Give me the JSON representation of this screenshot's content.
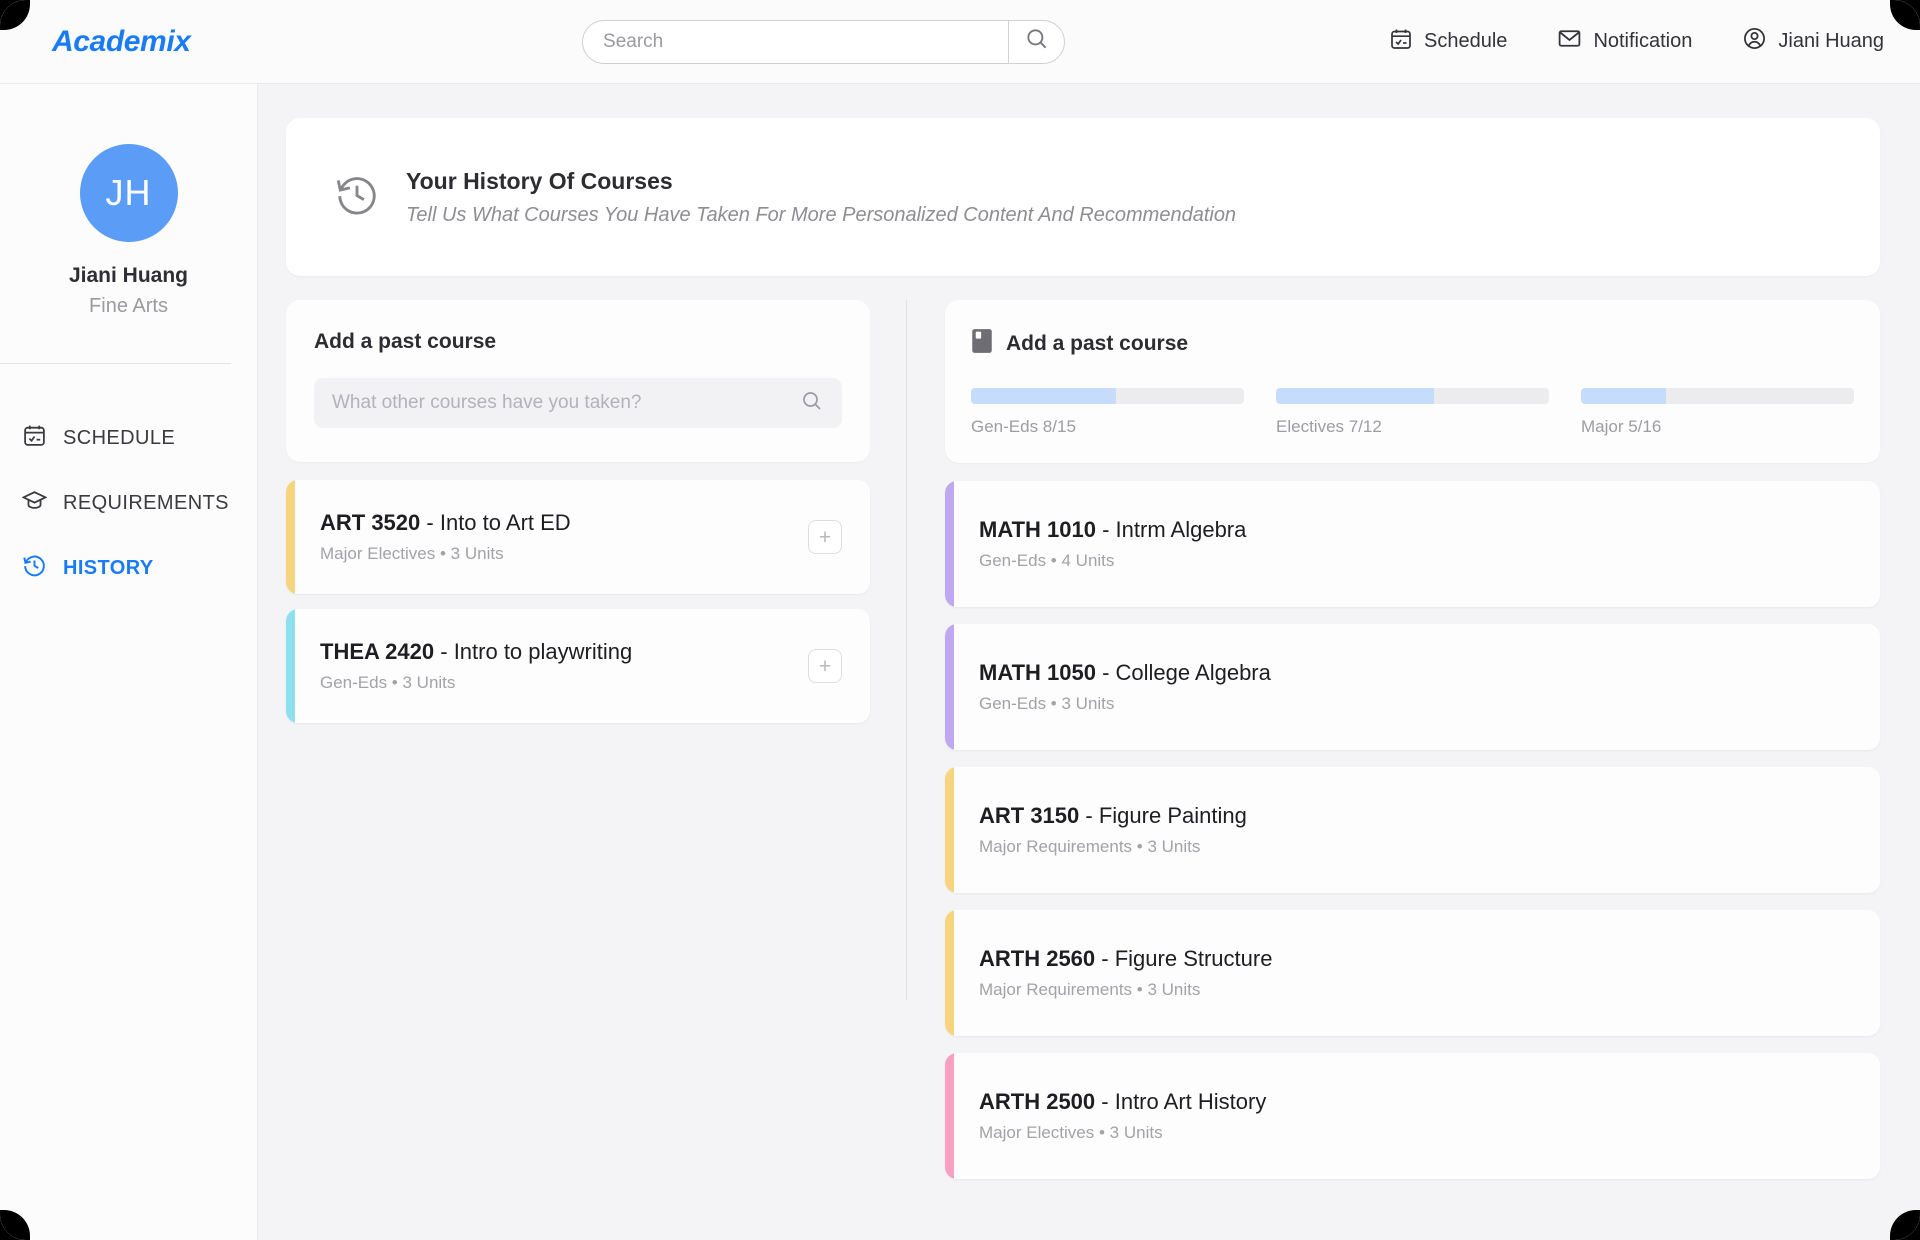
{
  "app": {
    "brand": "Academix"
  },
  "search": {
    "placeholder": "Search",
    "value": "",
    "icon": "search-icon"
  },
  "topnav": [
    {
      "label": "Schedule",
      "icon": "calendar-check-icon"
    },
    {
      "label": "Notification",
      "icon": "envelope-icon"
    },
    {
      "label": "Jiani Huang",
      "icon": "user-circle-icon"
    }
  ],
  "sidebar": {
    "profile": {
      "initials": "JH",
      "name": "Jiani Huang",
      "major": "Fine Arts",
      "avatar_color": "#5b9cf6"
    },
    "items": [
      {
        "label": "SCHEDULE",
        "icon": "calendar-icon",
        "active": false
      },
      {
        "label": "REQUIREMENTS",
        "icon": "graduation-cap-icon",
        "active": false
      },
      {
        "label": "HISTORY",
        "icon": "clock-rewind-icon",
        "active": true
      }
    ],
    "active_color": "#1a7cf5"
  },
  "banner": {
    "icon": "clock-rewind-icon",
    "title": "Your History Of Courses",
    "subtitle": "Tell Us What Courses You Have Taken For More Personalized Content And Recommendation"
  },
  "left_panel": {
    "title": "Add a past course",
    "input_placeholder": "What other courses have you taken?",
    "input_value": "",
    "search_icon": "search-icon",
    "courses": [
      {
        "code": "ART 3520",
        "separator": " - ",
        "name": "Into to Art ED",
        "meta": "Major Electives • 3 Units",
        "accent": "#f7d57f",
        "action": "+"
      },
      {
        "code": "THEA 2420",
        "separator": "  - ",
        "name": "Intro to playwriting",
        "meta": "Gen-Eds • 3 Units",
        "accent": "#8fe0ef",
        "action": "+"
      }
    ]
  },
  "right_panel": {
    "title": "Add a past course",
    "icon": "book-icon",
    "progress": [
      {
        "label": "Gen-Eds  8/15",
        "completed": 8,
        "total": 15,
        "percent": 53
      },
      {
        "label": "Electives 7/12",
        "completed": 7,
        "total": 12,
        "percent": 58
      },
      {
        "label": "Major 5/16",
        "completed": 5,
        "total": 16,
        "percent": 31
      }
    ],
    "progress_color": "#c5ddfb",
    "courses": [
      {
        "code": "MATH 1010",
        "separator": " - ",
        "name": "Intrm Algebra",
        "meta": "Gen-Eds • 4 Units",
        "accent": "#bfa8f0"
      },
      {
        "code": "MATH 1050",
        "separator": " - ",
        "name": "College Algebra",
        "meta": "Gen-Eds • 3 Units",
        "accent": "#bfa8f0"
      },
      {
        "code": "ART 3150",
        "separator": " - ",
        "name": "Figure Painting",
        "meta": "Major Requirements • 3 Units",
        "accent": "#f7d57f"
      },
      {
        "code": "ARTH 2560",
        "separator": " - ",
        "name": "Figure Structure",
        "meta": "Major Requirements • 3 Units",
        "accent": "#f7d57f"
      },
      {
        "code": "ARTH 2500",
        "separator": " - ",
        "name": "Intro Art History",
        "meta": "Major Electives •  3 Units",
        "accent": "#f9a0c0"
      }
    ]
  }
}
